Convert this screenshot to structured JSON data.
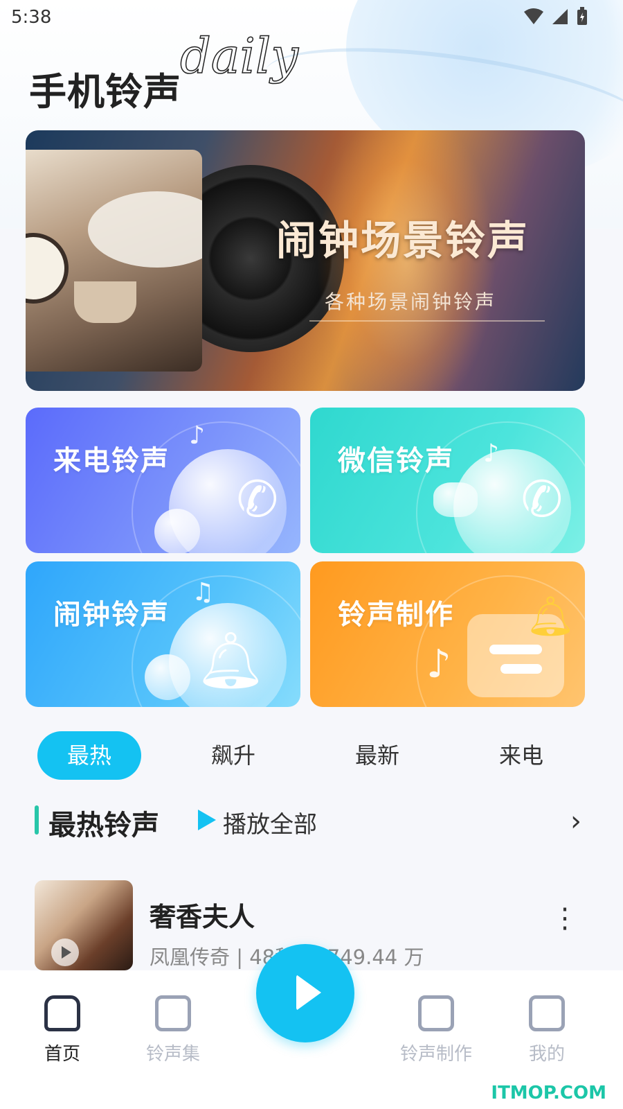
{
  "status_bar": {
    "time": "5:38"
  },
  "header": {
    "title": "手机铃声",
    "script_text": "daily"
  },
  "banner": {
    "title": "闹钟场景铃声",
    "subtitle": "各种场景闹钟铃声"
  },
  "categories": [
    {
      "label": "来电铃声",
      "color": "#5b6bfb"
    },
    {
      "label": "微信铃声",
      "color": "#2fd8cf"
    },
    {
      "label": "闹钟铃声",
      "color": "#2fa6fb"
    },
    {
      "label": "铃声制作",
      "color": "#ff9a1f"
    }
  ],
  "tabs": [
    {
      "label": "最热",
      "active": true
    },
    {
      "label": "飙升",
      "active": false
    },
    {
      "label": "最新",
      "active": false
    },
    {
      "label": "来电",
      "active": false
    }
  ],
  "section": {
    "title": "最热铃声",
    "play_all_label": "播放全部"
  },
  "songs": [
    {
      "name": "奢香夫人",
      "meta": "凤凰传奇 | 48秒 | 1749.44 万"
    }
  ],
  "bottom_nav": [
    {
      "label": "首页",
      "icon": "home-icon",
      "active": true
    },
    {
      "label": "铃声集",
      "icon": "music-collection-icon",
      "active": false
    },
    {
      "label": "铃声制作",
      "icon": "ringtone-maker-icon",
      "active": false
    },
    {
      "label": "我的",
      "icon": "profile-icon",
      "active": false
    }
  ],
  "watermark": "ITMOP.COM",
  "colors": {
    "accent": "#14c2f2",
    "section_bar": "#28c6a9"
  }
}
